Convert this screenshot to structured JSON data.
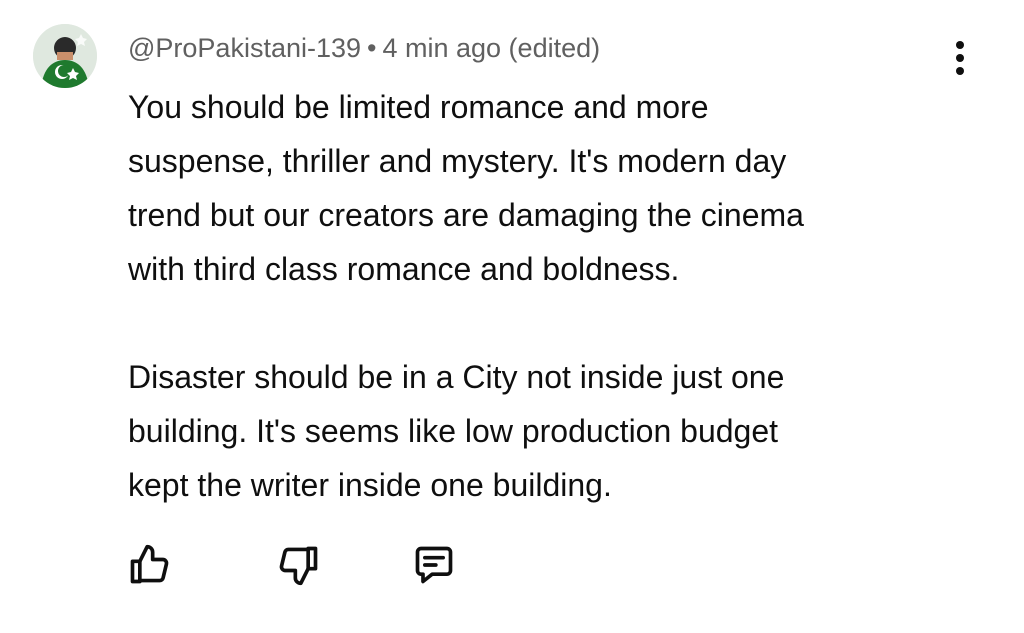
{
  "comment": {
    "author": "@ProPakistani-139",
    "separator": "•",
    "time": "4 min ago (edited)",
    "paragraphs": [
      "You should be limited romance and more\nsuspense, thriller and mystery. It's modern day\ntrend but our creators are damaging the cinema\nwith third class romance and boldness.",
      "Disaster should be in a City not inside just one\nbuilding. It's seems like low production budget\nkept the writer inside one building."
    ]
  },
  "icons": {
    "avatar": "avatar-image",
    "more": "more-vertical-icon",
    "like": "thumbs-up-icon",
    "dislike": "thumbs-down-icon",
    "reply": "reply-comment-icon"
  },
  "colors": {
    "meta_text": "#606060",
    "body_text": "#0f0f0f",
    "avatar_green": "#1f7a2e"
  }
}
